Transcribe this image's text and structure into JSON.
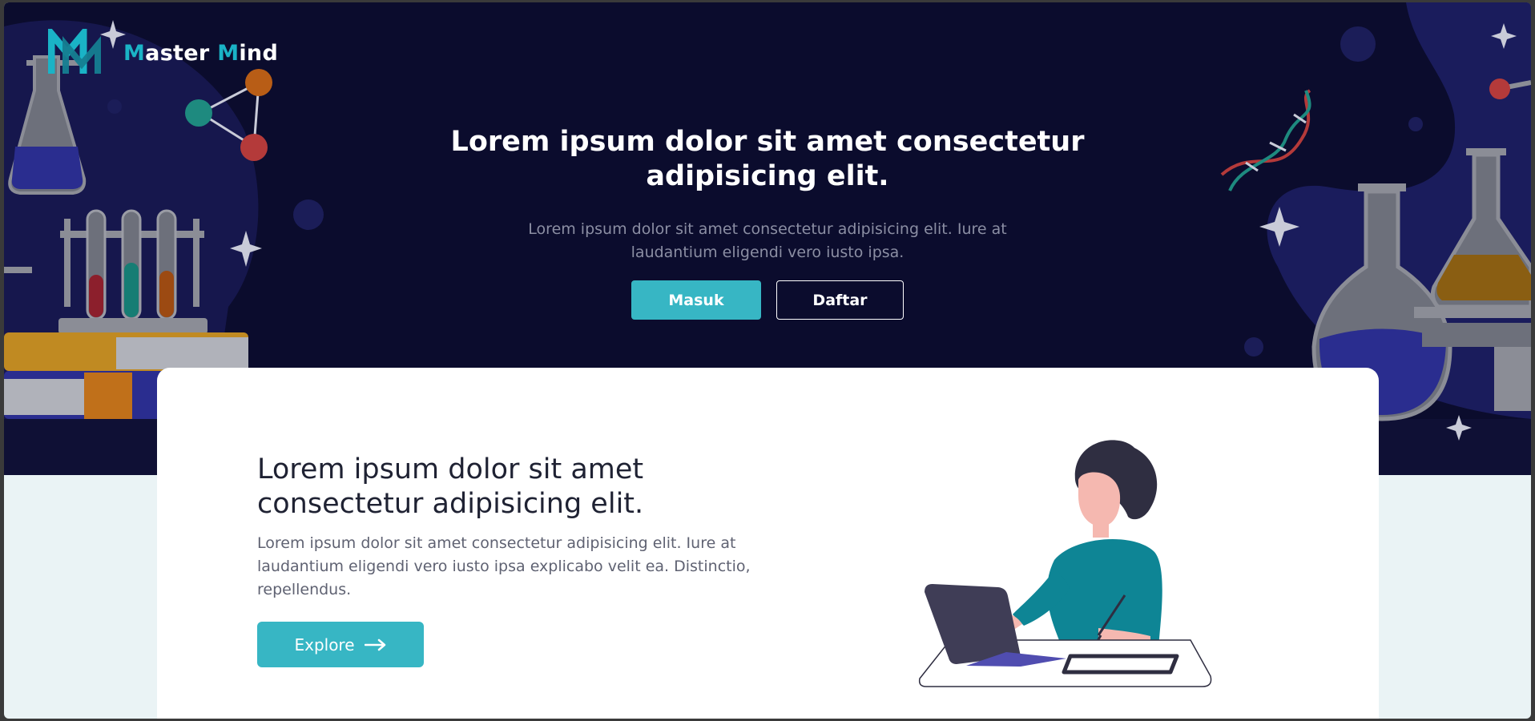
{
  "brand": {
    "name_accent_1": "M",
    "name_part_1": "aster ",
    "name_accent_2": "M",
    "name_part_2": "ind"
  },
  "hero": {
    "title": "Lorem ipsum dolor sit amet consectetur adipisicing elit.",
    "subtitle": "Lorem ipsum dolor sit amet consectetur adipisicing elit. Iure at laudantium eligendi vero iusto ipsa.",
    "login_label": "Masuk",
    "register_label": "Daftar"
  },
  "feature": {
    "title": "Lorem ipsum dolor sit amet consectetur adipisicing elit.",
    "text": "Lorem ipsum dolor sit amet consectetur adipisicing elit. Iure at laudantium eligendi vero iusto ipsa explicabo velit ea. Distinctio, repellendus.",
    "explore_label": "Explore"
  },
  "colors": {
    "accent": "#37b6c4",
    "hero_bg": "#0b0c2d",
    "section_bg": "#eaf3f5"
  },
  "icons": [
    "logo-mark-icon",
    "arrow-right-icon"
  ]
}
